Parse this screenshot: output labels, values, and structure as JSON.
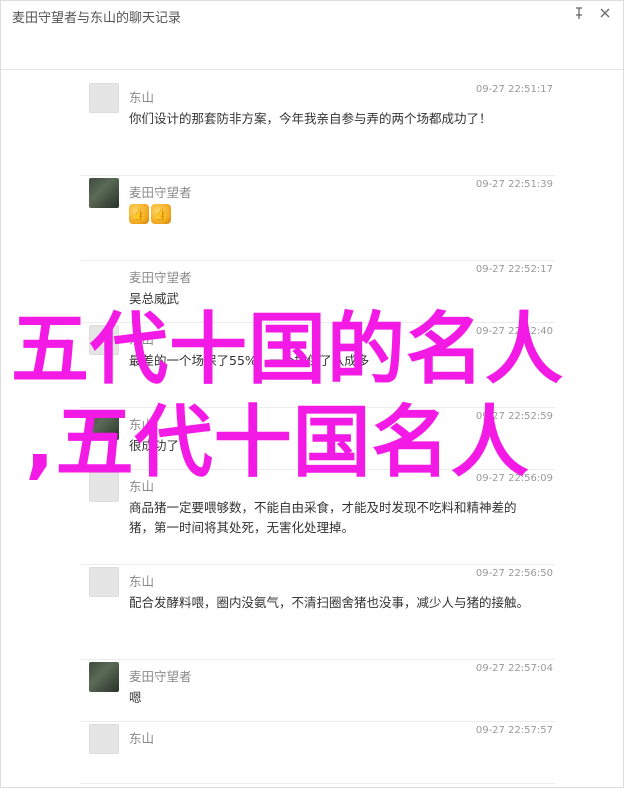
{
  "window": {
    "title": "麦田守望者与东山的聊天记录"
  },
  "messages": [
    {
      "sender": "东山",
      "time": "09-27 22:51:17",
      "text": "你们设计的那套防非方案，今年我亲自参与弄的两个场都成功了！",
      "avatar": "default"
    },
    {
      "sender": "麦田守望者",
      "time": "09-27 22:51:39",
      "text": "👍👍",
      "avatar": "photo"
    },
    {
      "sender": "麦田守望者",
      "time": "09-27 22:52:17",
      "text": "吴总威武",
      "avatar": "none"
    },
    {
      "sender": "东山",
      "time": "09-27 22:52:40",
      "text": "最差的一个场保了55%，一个场保了八成多",
      "avatar": "default"
    },
    {
      "sender": "东山",
      "time": "09-27 22:52:59",
      "text": "很成功了",
      "avatar": "photo"
    },
    {
      "sender": "东山",
      "time": "09-27 22:56:09",
      "text": "商品猪一定要喂够数，不能自由采食，才能及时发现不吃料和精神差的猪，第一时间将其处死，无害化处理掉。",
      "avatar": "default"
    },
    {
      "sender": "东山",
      "time": "09-27 22:56:50",
      "text": "配合发酵料喂，圈内没氨气，不清扫圈舍猪也没事，减少人与猪的接触。",
      "avatar": "default"
    },
    {
      "sender": "麦田守望者",
      "time": "09-27 22:57:04",
      "text": "嗯",
      "avatar": "photo"
    },
    {
      "sender": "东山",
      "time": "09-27 22:57:57",
      "text": "",
      "avatar": "default"
    }
  ],
  "overlay": {
    "line1": "五代十国的名人",
    "line2": ",五代十国名人"
  },
  "colors": {
    "overlay": "#f41ae6",
    "name": "#8a8a8a",
    "time": "#999999"
  },
  "icons": [
    "pin-icon",
    "close-icon"
  ]
}
